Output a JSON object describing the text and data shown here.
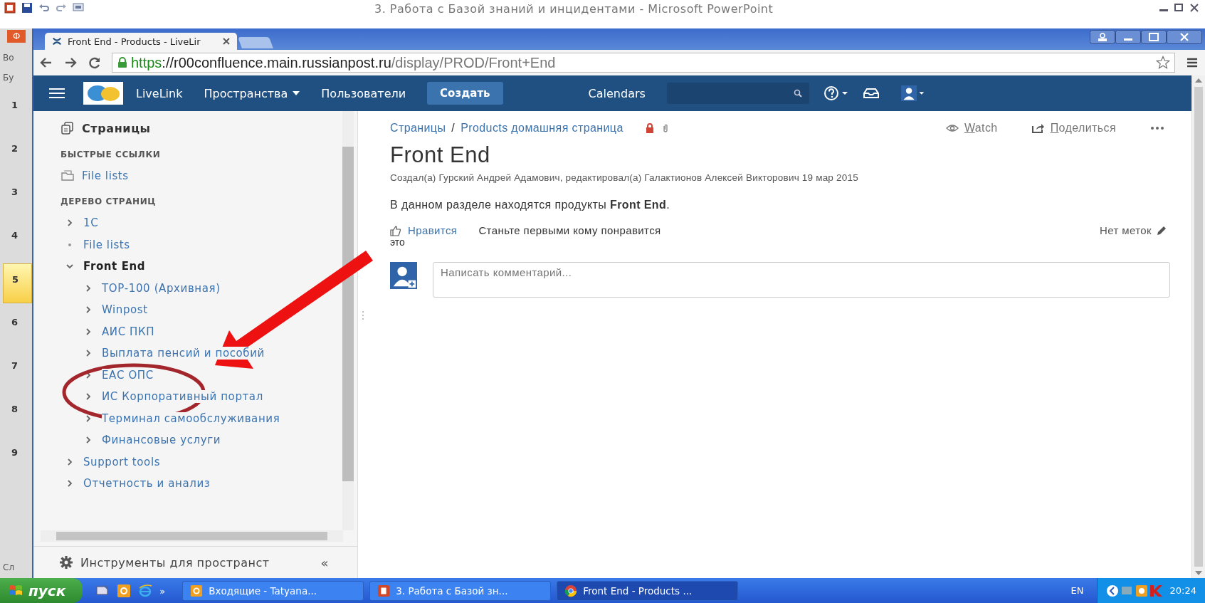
{
  "powerpoint": {
    "title": "3. Работа с Базой знаний и инцидентами - Microsoft PowerPoint",
    "file_tab": "Ф",
    "side_fragments": [
      "Во",
      "Бу"
    ],
    "slides": [
      {
        "number": "1",
        "selected": false
      },
      {
        "number": "2",
        "selected": false
      },
      {
        "number": "3",
        "selected": false
      },
      {
        "number": "4",
        "selected": false
      },
      {
        "number": "5",
        "selected": true
      },
      {
        "number": "6",
        "selected": false
      },
      {
        "number": "7",
        "selected": false
      },
      {
        "number": "8",
        "selected": false
      },
      {
        "number": "9",
        "selected": false
      }
    ],
    "status_fragment": "Сл"
  },
  "browser": {
    "tabs": [
      {
        "title": "Front End - Products - LiveLir",
        "selected": true
      }
    ],
    "url": {
      "scheme": "https",
      "host": "://r00confluence.main.russianpost.ru",
      "path": "/display/PROD/Front+End"
    }
  },
  "header": {
    "app_name": "LiveLink",
    "nav": [
      {
        "label": "Пространства",
        "dropdown": true
      },
      {
        "label": "Пользователи",
        "dropdown": false
      }
    ],
    "create_button": "Создать",
    "calendars": "Calendars"
  },
  "sidebar": {
    "title": "Страницы",
    "quick_links_heading": "БЫСТРЫЕ ССЫЛКИ",
    "quick_links": [
      "File lists"
    ],
    "tree_heading": "ДЕРЕВО СТРАНИЦ",
    "tree": [
      {
        "label": "1С",
        "kind": "branch",
        "expanded": false,
        "selected": false
      },
      {
        "label": "File lists",
        "kind": "leaf",
        "selected": false
      },
      {
        "label": "Front End",
        "kind": "branch",
        "expanded": true,
        "selected": true,
        "children": [
          {
            "label": "ТОР-100 (Архивная)",
            "kind": "branch",
            "expanded": false,
            "selected": false
          },
          {
            "label": "Winpost",
            "kind": "branch",
            "expanded": false,
            "selected": false
          },
          {
            "label": "АИС ПКП",
            "kind": "branch",
            "expanded": false,
            "selected": false
          },
          {
            "label": "Выплата пенсий и пособий",
            "kind": "branch",
            "expanded": false,
            "selected": false
          },
          {
            "label": "ЕАС ОПС",
            "kind": "branch",
            "expanded": false,
            "selected": false
          },
          {
            "label": "ИС Корпоративный портал",
            "kind": "branch",
            "expanded": false,
            "selected": false
          },
          {
            "label": "Терминал самообслуживания",
            "kind": "branch",
            "expanded": false,
            "selected": false
          },
          {
            "label": "Финансовые услуги",
            "kind": "branch",
            "expanded": false,
            "selected": false
          }
        ]
      },
      {
        "label": "Support tools",
        "kind": "branch",
        "expanded": false,
        "selected": false
      },
      {
        "label": "Отчетность и анализ",
        "kind": "branch",
        "expanded": false,
        "selected": false
      }
    ],
    "footer": "Инструменты для пространст",
    "collapse": "«"
  },
  "page": {
    "breadcrumbs": [
      "Страницы",
      "Products домашняя страница"
    ],
    "breadcrumb_separator": "/",
    "watch": "Watch",
    "share": "Поделиться",
    "title": "Front End",
    "byline": "Создал(а) Гурский Андрей Адамович, редактировал(а) Галактионов Алексей Викторович 19 мар 2015",
    "body": "В данном разделе находятся продукты **Front End**.",
    "like": "Нравится",
    "like_prompt": "Станьте первыми кому понравится",
    "like_prompt_tail": "это",
    "labels": "Нет меток",
    "comment_placeholder": "Написать комментарий..."
  },
  "taskbar": {
    "start": "пуск",
    "more": "»",
    "tasks": [
      {
        "title": "Входящие - Tatyana...",
        "kind": "outlook",
        "selected": false
      },
      {
        "title": "3. Работа с Базой зн...",
        "kind": "powerpoint",
        "selected": false
      },
      {
        "title": "Front End - Products ...",
        "kind": "chrome",
        "selected": true
      }
    ],
    "language": "EN",
    "time": "20:24"
  }
}
